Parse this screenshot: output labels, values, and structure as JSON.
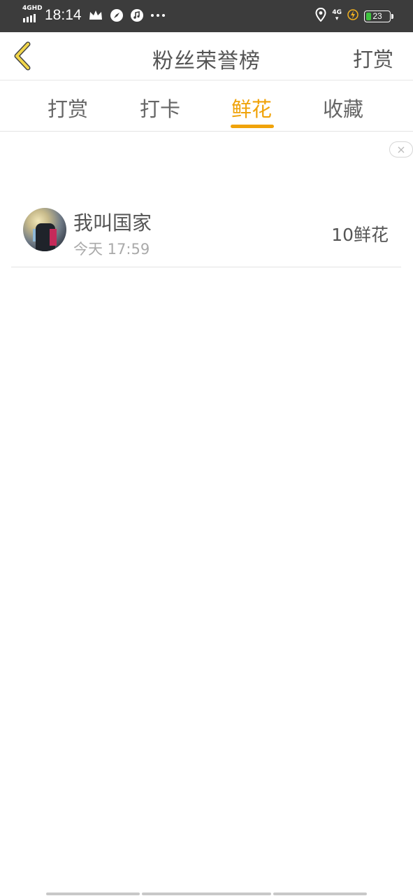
{
  "status_bar": {
    "network_tag": "4GHD",
    "time": "18:14",
    "net_right": "4G",
    "battery": "23",
    "icons": [
      "signal-icon",
      "crown-icon",
      "compass-icon",
      "music-icon",
      "more-icon",
      "location-icon",
      "charging-icon",
      "battery-icon"
    ]
  },
  "nav": {
    "title": "粉丝荣誉榜",
    "action": "打赏",
    "back_icon": "chevron-left-icon"
  },
  "tabs": [
    {
      "label": "打赏",
      "active": false
    },
    {
      "label": "打卡",
      "active": false
    },
    {
      "label": "鲜花",
      "active": true
    },
    {
      "label": "收藏",
      "active": false
    }
  ],
  "colors": {
    "accent": "#f0a30a",
    "back_icon": "#f2d64a",
    "status_bar": "#3c3c3c"
  },
  "list": [
    {
      "name": "我叫国家",
      "time": "今天 17:59",
      "count": "10鲜花"
    }
  ]
}
